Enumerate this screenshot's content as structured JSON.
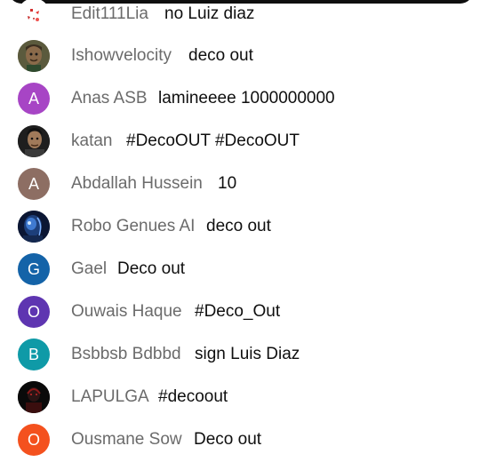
{
  "chat": {
    "messages": [
      {
        "author": "Edit111Lia",
        "text": "no Luiz diaz",
        "avatar": {
          "type": "image",
          "icon": "heart-sticker-avatar"
        }
      },
      {
        "author": "Ishowvelocity",
        "text": "deco out",
        "avatar": {
          "type": "image",
          "icon": "cartoon-face-avatar"
        }
      },
      {
        "author": "Anas ASB",
        "text": "lamineeee 1000000000",
        "avatar": {
          "type": "letter",
          "letter": "A",
          "color": "#a745c5"
        }
      },
      {
        "author": "katan",
        "text": "#DecoOUT #DecoOUT",
        "avatar": {
          "type": "image",
          "icon": "person-photo-avatar"
        }
      },
      {
        "author": "Abdallah Hussein",
        "text": "10",
        "avatar": {
          "type": "letter",
          "letter": "A",
          "color": "#8d6e63"
        }
      },
      {
        "author": "Robo Genues AI",
        "text": "deco out",
        "avatar": {
          "type": "image",
          "icon": "robot-avatar"
        }
      },
      {
        "author": "Gael",
        "text": "Deco out",
        "avatar": {
          "type": "letter",
          "letter": "G",
          "color": "#1463a8"
        }
      },
      {
        "author": "Ouwais Haque",
        "text": "#Deco_Out",
        "avatar": {
          "type": "letter",
          "letter": "O",
          "color": "#5e35b1"
        }
      },
      {
        "author": "Bsbbsb Bdbbd",
        "text": "sign Luis Diaz",
        "avatar": {
          "type": "letter",
          "letter": "B",
          "color": "#0f9aa7"
        }
      },
      {
        "author": "LAPULGA",
        "text": "#decoout",
        "avatar": {
          "type": "image",
          "icon": "dark-figure-avatar"
        }
      },
      {
        "author": "Ousmane Sow",
        "text": "Deco out",
        "avatar": {
          "type": "letter",
          "letter": "O",
          "color": "#f4511e"
        }
      }
    ]
  }
}
